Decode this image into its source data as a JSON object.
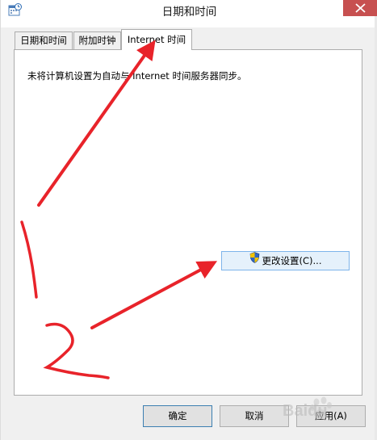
{
  "window": {
    "title": "日期和时间",
    "colors": {
      "close": "#c75050",
      "tab_border": "#acacac",
      "button_hover": "#e5f1fb",
      "annotation": "#e8232a"
    }
  },
  "tabs": [
    {
      "label": "日期和时间",
      "active": false
    },
    {
      "label": "附加时钟",
      "active": false
    },
    {
      "label": "Internet 时间",
      "active": true
    }
  ],
  "panel": {
    "info_text": "未将计算机设置为自动与 Internet 时间服务器同步。",
    "change_settings_label": "更改设置(C)..."
  },
  "buttons": {
    "ok": "确定",
    "cancel": "取消",
    "apply": "应用(A)"
  },
  "icons": {
    "app": "clock-calendar-icon",
    "close": "close-icon",
    "shield": "uac-shield-icon"
  },
  "annotations": {
    "step_1": "1",
    "step_2": "2"
  },
  "watermark": {
    "text": "Baidu"
  }
}
